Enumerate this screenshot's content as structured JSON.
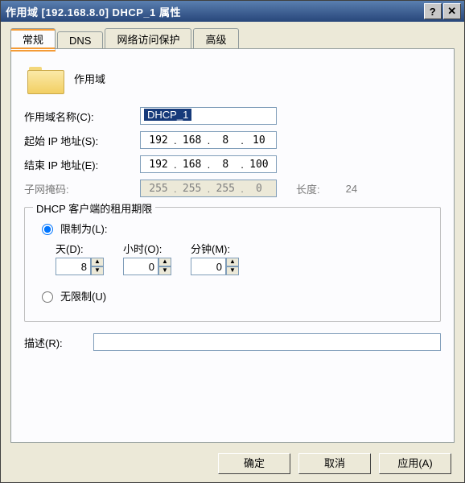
{
  "title": "作用域 [192.168.8.0] DHCP_1 属性",
  "tabs": {
    "general": "常规",
    "dns": "DNS",
    "nap": "网络访问保护",
    "advanced": "高级"
  },
  "header_label": "作用域",
  "fields": {
    "scope_name_label": "作用域名称(C):",
    "scope_name_value": "DHCP_1",
    "start_ip_label": "起始 IP 地址(S):",
    "start_ip": [
      "192",
      "168",
      "8",
      "10"
    ],
    "end_ip_label": "结束 IP 地址(E):",
    "end_ip": [
      "192",
      "168",
      "8",
      "100"
    ],
    "mask_label": "子网掩码:",
    "mask": [
      "255",
      "255",
      "255",
      "0"
    ],
    "length_label": "长度:",
    "length_value": "24"
  },
  "lease": {
    "group_title": "DHCP 客户端的租用期限",
    "limited_label": "限制为(L):",
    "days_label": "天(D):",
    "days_value": "8",
    "hours_label": "小时(O):",
    "hours_value": "0",
    "minutes_label": "分钟(M):",
    "minutes_value": "0",
    "unlimited_label": "无限制(U)"
  },
  "description_label": "描述(R):",
  "description_value": "",
  "buttons": {
    "ok": "确定",
    "cancel": "取消",
    "apply": "应用(A)"
  }
}
